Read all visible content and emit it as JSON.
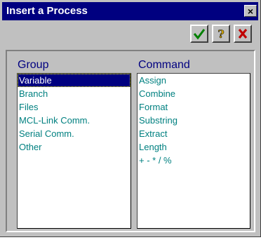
{
  "dialog": {
    "title": "Insert a Process",
    "close_label": "×"
  },
  "toolbar": {
    "ok_icon": "checkmark-icon",
    "help_icon": "question-mark-icon",
    "cancel_icon": "x-icon"
  },
  "group": {
    "header": "Group",
    "items": [
      "Variable",
      "Branch",
      "Files",
      "MCL-Link Comm.",
      "Serial Comm.",
      "Other"
    ],
    "selected": "Variable"
  },
  "command": {
    "header": "Command",
    "items": [
      "Assign",
      "Combine",
      "Format",
      "Substring",
      "Extract",
      "Length",
      "+ - * / %"
    ]
  },
  "colors": {
    "titlebar": "#000080",
    "list_text": "#008080",
    "ok": "#008000",
    "help": "#c8a000",
    "cancel": "#c00000"
  }
}
